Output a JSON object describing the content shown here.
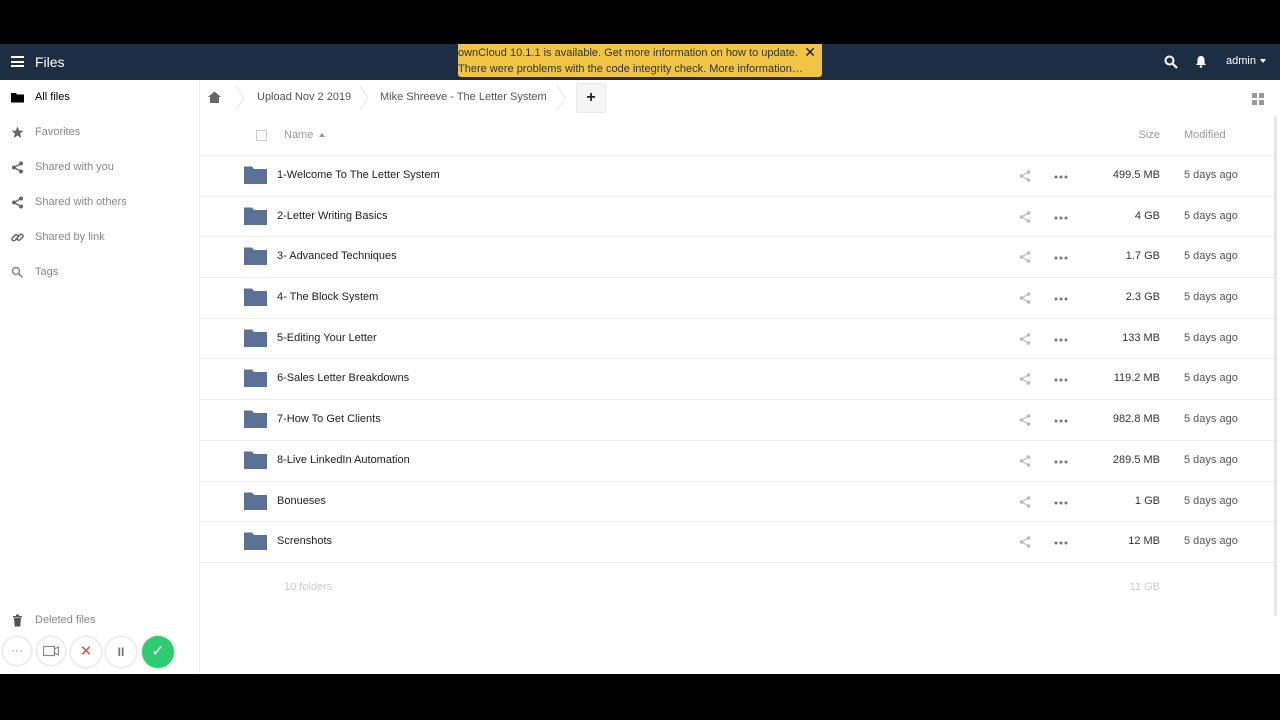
{
  "colors": {
    "header_bg": "#1d2d44",
    "notification_bg": "#f0c545",
    "folder": "#5b7196",
    "confirm_green": "#2ecc71",
    "cancel_red": "#e74c3c"
  },
  "header": {
    "app_title": "Files",
    "user": "admin",
    "notification": {
      "line1": "ownCloud 10.1.1 is available. Get more information on how to update.",
      "line2": "There were problems with the code integrity check. More information…",
      "close": "✕"
    }
  },
  "sidebar": {
    "items": [
      {
        "label": "All files",
        "icon": "folder-icon"
      },
      {
        "label": "Favorites",
        "icon": "star-icon"
      },
      {
        "label": "Shared with you",
        "icon": "share-icon"
      },
      {
        "label": "Shared with others",
        "icon": "share-icon"
      },
      {
        "label": "Shared by link",
        "icon": "link-icon"
      },
      {
        "label": "Tags",
        "icon": "tag-search-icon"
      }
    ],
    "deleted_files": "Deleted files"
  },
  "breadcrumb": {
    "items": [
      {
        "label": "Upload Nov 2 2019"
      },
      {
        "label": "Mike Shreeve - The Letter System"
      }
    ],
    "new_button": "+"
  },
  "table": {
    "headers": {
      "name": "Name",
      "size": "Size",
      "modified": "Modified"
    },
    "rows": [
      {
        "name": "1-Welcome To The Letter System",
        "size": "499.5 MB",
        "modified": "5 days ago"
      },
      {
        "name": "2-Letter Writing Basics",
        "size": "4 GB",
        "modified": "5 days ago"
      },
      {
        "name": "3- Advanced Techniques",
        "size": "1.7 GB",
        "modified": "5 days ago"
      },
      {
        "name": "4- The Block System",
        "size": "2.3 GB",
        "modified": "5 days ago"
      },
      {
        "name": "5-Editing Your Letter",
        "size": "133 MB",
        "modified": "5 days ago"
      },
      {
        "name": "6-Sales Letter Breakdowns",
        "size": "119.2 MB",
        "modified": "5 days ago"
      },
      {
        "name": "7-How To Get Clients",
        "size": "982.8 MB",
        "modified": "5 days ago"
      },
      {
        "name": "8-Live LinkedIn Automation",
        "size": "289.5 MB",
        "modified": "5 days ago"
      },
      {
        "name": "Bonueses",
        "size": "1 GB",
        "modified": "5 days ago"
      },
      {
        "name": "Screnshots",
        "size": "12 MB",
        "modified": "5 days ago"
      }
    ],
    "summary": {
      "folders": "10 folders",
      "size": "11 GB"
    }
  },
  "recorder": {
    "more": "···",
    "cancel": "✕",
    "pause": "II",
    "confirm": "✓"
  }
}
